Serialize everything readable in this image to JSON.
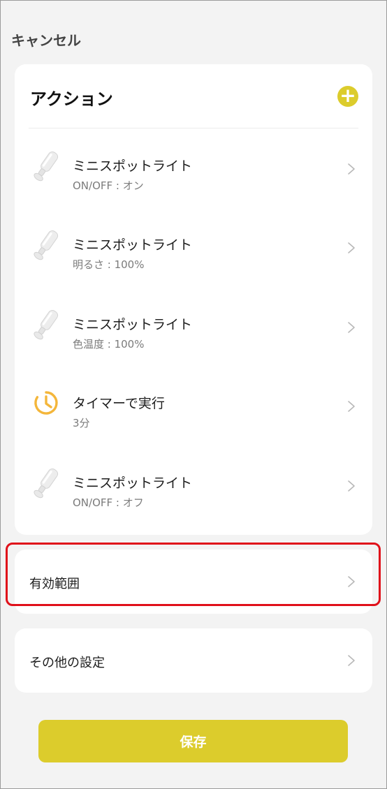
{
  "header": {
    "cancel_label": "キャンセル"
  },
  "action_section": {
    "title": "アクション",
    "add_icon": "plus-icon",
    "items": [
      {
        "name": "ミニスポットライト",
        "detail": "ON/OFF : オン",
        "icon": "spotlight-icon"
      },
      {
        "name": "ミニスポットライト",
        "detail": "明るさ : 100%",
        "icon": "spotlight-icon"
      },
      {
        "name": "ミニスポットライト",
        "detail": "色温度 : 100%",
        "icon": "spotlight-icon"
      },
      {
        "name": "タイマーで実行",
        "detail": "3分",
        "icon": "timer-icon"
      },
      {
        "name": "ミニスポットライト",
        "detail": "ON/OFF : オフ",
        "icon": "spotlight-icon"
      }
    ]
  },
  "effective_range": {
    "label": "有効範囲"
  },
  "other_settings": {
    "label": "その他の設定"
  },
  "save_button": {
    "label": "保存"
  },
  "colors": {
    "accent": "#dccc2c",
    "highlight": "#e0101a",
    "timer": "#f4b63a",
    "background": "#f3f3f3"
  }
}
